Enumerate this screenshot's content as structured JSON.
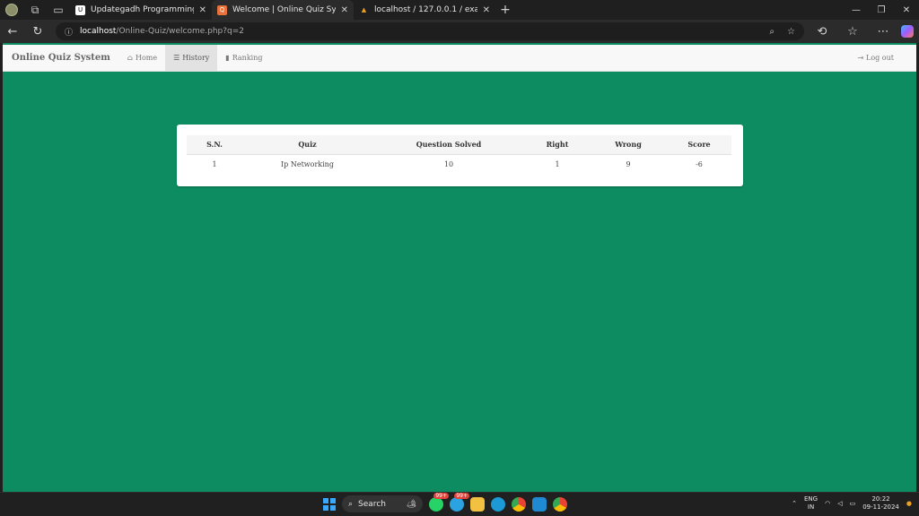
{
  "browser": {
    "tabs": [
      {
        "title": "Updategadh Programming - Upd",
        "favicon_color": "#ffffff",
        "favicon_text": "U"
      },
      {
        "title": "Welcome | Online Quiz System",
        "favicon_color": "#e8713c",
        "favicon_text": "Q"
      },
      {
        "title": "localhost / 127.0.0.1 / exam / use",
        "favicon_color": "#f0a020",
        "favicon_text": "▲"
      }
    ],
    "url_host": "localhost",
    "url_path": "/Online-Quiz/welcome.php?q=2"
  },
  "app": {
    "brand": "Online Quiz System",
    "nav": {
      "home": "Home",
      "history": "History",
      "ranking": "Ranking",
      "logout": "Log out"
    }
  },
  "history_table": {
    "headers": [
      "S.N.",
      "Quiz",
      "Question Solved",
      "Right",
      "Wrong",
      "Score"
    ],
    "rows": [
      [
        "1",
        "Ip Networking",
        "10",
        "1",
        "9",
        "-6"
      ]
    ]
  },
  "taskbar": {
    "search_label": "Search",
    "badge1": "99+",
    "badge2": "99+",
    "lang_top": "ENG",
    "lang_bottom": "IN",
    "time": "20:22",
    "date": "09-11-2024"
  },
  "colors": {
    "page_background": "#0d8c62",
    "navbar_background": "#f8f8f8"
  }
}
